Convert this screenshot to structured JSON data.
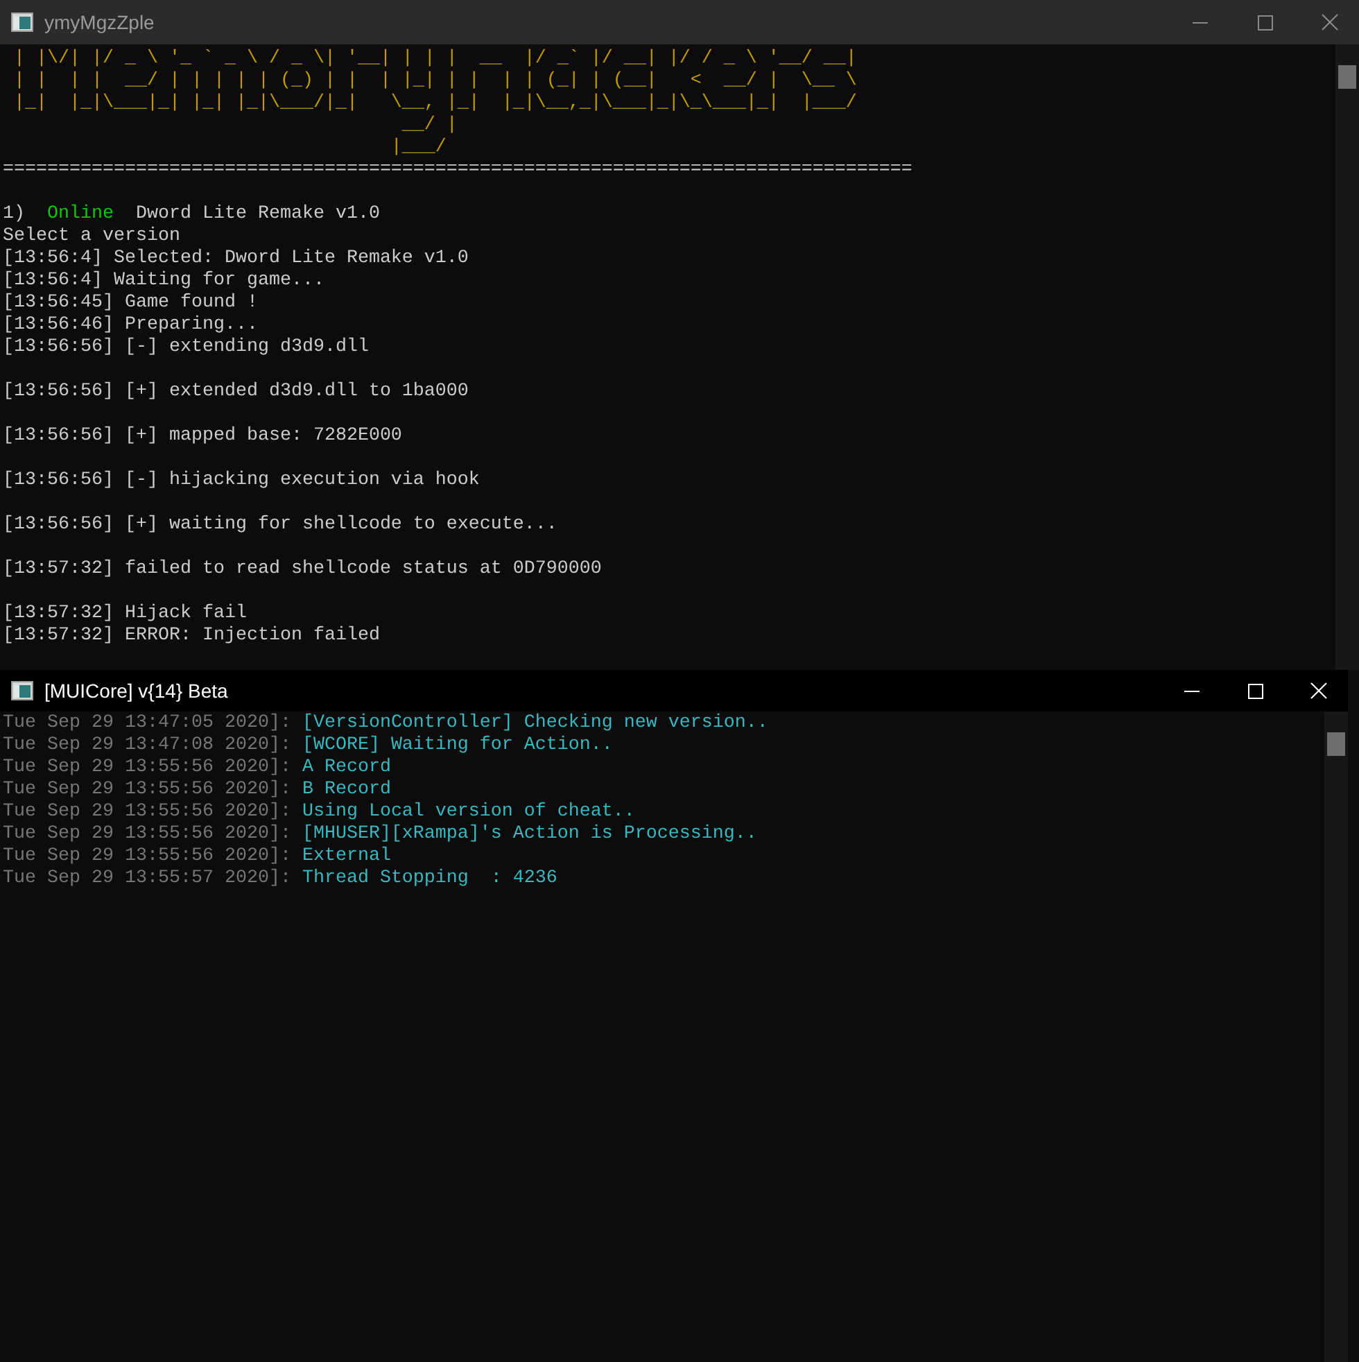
{
  "windows": [
    {
      "title": "ymyMgzZple",
      "active": false,
      "ascii_art": [
        " | |\\/| |/ _ \\ '_ ` _ \\ / _ \\| '__| | | |  __  |/ _` |/ __| |/ / _ \\ '__/ __|",
        " | |  | |  __/ | | | | | (_) | |  | |_| | |  | | (_| | (__|   <  __/ |  \\__ \\",
        " |_|  |_|\\___|_| |_| |_|\\___/|_|   \\__, |_|  |_|\\__,_|\\___|_|\\_\\___|_|  |___/",
        "                                    __/ |",
        "                                   |___/"
      ],
      "separator": "==================================================================================",
      "menu_entry": {
        "number": "1)",
        "status": "Online",
        "name": "Dword Lite Remake v1.0"
      },
      "lines": [
        {
          "kind": "line",
          "text": "Select a version"
        },
        {
          "kind": "line",
          "text": "[13:56:4] Selected: Dword Lite Remake v1.0"
        },
        {
          "kind": "line",
          "text": "[13:56:4] Waiting for game..."
        },
        {
          "kind": "line",
          "text": "[13:56:45] Game found !"
        },
        {
          "kind": "line",
          "text": "[13:56:46] Preparing..."
        },
        {
          "kind": "spaced",
          "text": "[13:56:56] [-] extending d3d9.dll"
        },
        {
          "kind": "spaced",
          "text": "[13:56:56] [+] extended d3d9.dll to 1ba000"
        },
        {
          "kind": "spaced",
          "text": "[13:56:56] [+] mapped base: 7282E000"
        },
        {
          "kind": "spaced",
          "text": "[13:56:56] [-] hijacking execution via hook"
        },
        {
          "kind": "spaced",
          "text": "[13:56:56] [+] waiting for shellcode to execute..."
        },
        {
          "kind": "spaced",
          "text": "[13:57:32] failed to read shellcode status at 0D790000"
        },
        {
          "kind": "line",
          "text": "[13:57:32] Hijack fail"
        },
        {
          "kind": "line",
          "text": "[13:57:32] ERROR: Injection failed"
        }
      ]
    },
    {
      "title": "[MUICore] v{14} Beta",
      "active": true,
      "entries": [
        {
          "timestamp": "Tue Sep 29 13:47:05 2020]:",
          "message": "[VersionController] Checking new version.."
        },
        {
          "timestamp": "Tue Sep 29 13:47:08 2020]:",
          "message": "[WCORE] Waiting for Action.."
        },
        {
          "timestamp": "Tue Sep 29 13:55:56 2020]:",
          "message": "A Record"
        },
        {
          "timestamp": "Tue Sep 29 13:55:56 2020]:",
          "message": "B Record"
        },
        {
          "timestamp": "Tue Sep 29 13:55:56 2020]:",
          "message": "Using Local version of cheat.."
        },
        {
          "timestamp": "Tue Sep 29 13:55:56 2020]:",
          "message": "[MHUSER][xRampa]'s Action is Processing.."
        },
        {
          "timestamp": "Tue Sep 29 13:55:56 2020]:",
          "message": "External"
        },
        {
          "timestamp": "Tue Sep 29 13:55:57 2020]:",
          "message": "Thread Stopping  : 4236"
        }
      ]
    }
  ]
}
